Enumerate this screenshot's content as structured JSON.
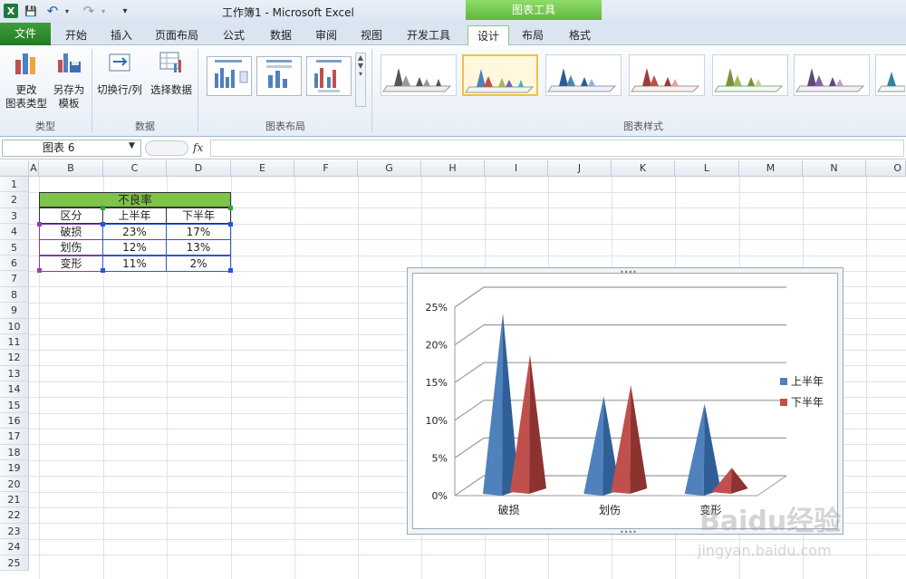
{
  "window": {
    "title": "工作簿1 - Microsoft Excel",
    "app_icon": "X"
  },
  "quick_access": {
    "save": "💾",
    "undo": "↶",
    "redo": "↷",
    "customize": "▾"
  },
  "context_header": "图表工具",
  "tabs": [
    {
      "id": "file",
      "label": "文件"
    },
    {
      "id": "home",
      "label": "开始"
    },
    {
      "id": "insert",
      "label": "插入"
    },
    {
      "id": "pagelayout",
      "label": "页面布局"
    },
    {
      "id": "formulas",
      "label": "公式"
    },
    {
      "id": "data",
      "label": "数据"
    },
    {
      "id": "review",
      "label": "审阅"
    },
    {
      "id": "view",
      "label": "视图"
    },
    {
      "id": "developer",
      "label": "开发工具"
    },
    {
      "id": "design",
      "label": "设计"
    },
    {
      "id": "layout",
      "label": "布局"
    },
    {
      "id": "format",
      "label": "格式"
    }
  ],
  "ribbon": {
    "type_group": {
      "label": "类型",
      "change_type": [
        "更改",
        "图表类型"
      ],
      "save_template": [
        "另存为",
        "模板"
      ]
    },
    "data_group": {
      "label": "数据",
      "switch": "切换行/列",
      "select": "选择数据"
    },
    "layout_group": {
      "label": "图表布局"
    },
    "style_group": {
      "label": "图表样式"
    }
  },
  "formula_bar": {
    "name_box": "图表 6",
    "fx": "fx",
    "formula": ""
  },
  "columns": [
    "A",
    "B",
    "C",
    "D",
    "E",
    "F",
    "G",
    "H",
    "I",
    "J",
    "K",
    "L",
    "M",
    "N",
    "O"
  ],
  "rows": [
    "1",
    "2",
    "3",
    "4",
    "5",
    "6",
    "7",
    "8",
    "9",
    "10",
    "11",
    "12",
    "13",
    "14",
    "15",
    "16",
    "17",
    "18",
    "19",
    "20",
    "21",
    "22",
    "23",
    "24",
    "25"
  ],
  "table": {
    "title": "不良率",
    "headers": [
      "区分",
      "上半年",
      "下半年"
    ],
    "rows": [
      [
        "破损",
        "23%",
        "17%"
      ],
      [
        "划伤",
        "12%",
        "13%"
      ],
      [
        "变形",
        "11%",
        "2%"
      ]
    ]
  },
  "colors": {
    "series1": "#4f81bd",
    "series2": "#c0504d",
    "accent_green": "#7ec34a"
  },
  "chart_data": {
    "type": "bar",
    "style": "3d-cone",
    "categories": [
      "破损",
      "划伤",
      "变形"
    ],
    "series": [
      {
        "name": "上半年",
        "values": [
          23,
          12,
          11
        ]
      },
      {
        "name": "下半年",
        "values": [
          17,
          13,
          2
        ]
      }
    ],
    "ylim": [
      0,
      25
    ],
    "yticks": [
      "0%",
      "5%",
      "10%",
      "15%",
      "20%",
      "25%"
    ],
    "legend": "right",
    "grid": true
  }
}
